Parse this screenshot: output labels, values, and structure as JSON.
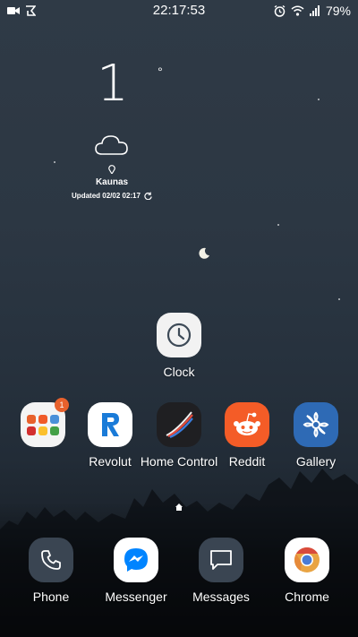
{
  "status_bar": {
    "time": "22:17:53",
    "battery": "79%"
  },
  "weather": {
    "temperature": "1",
    "degree": "°",
    "location": "Kaunas",
    "updated": "Updated 02/02 02:17"
  },
  "apps": {
    "clock": "Clock",
    "folder_badge": "1",
    "revolut": "Revolut",
    "home_control": "Home Control",
    "reddit": "Reddit",
    "gallery": "Gallery"
  },
  "dock": {
    "phone": "Phone",
    "messenger": "Messenger",
    "messages": "Messages",
    "chrome": "Chrome"
  },
  "colors": {
    "reddit": "#f45c27",
    "messenger": "#0084ff",
    "badge": "#e8612c"
  }
}
